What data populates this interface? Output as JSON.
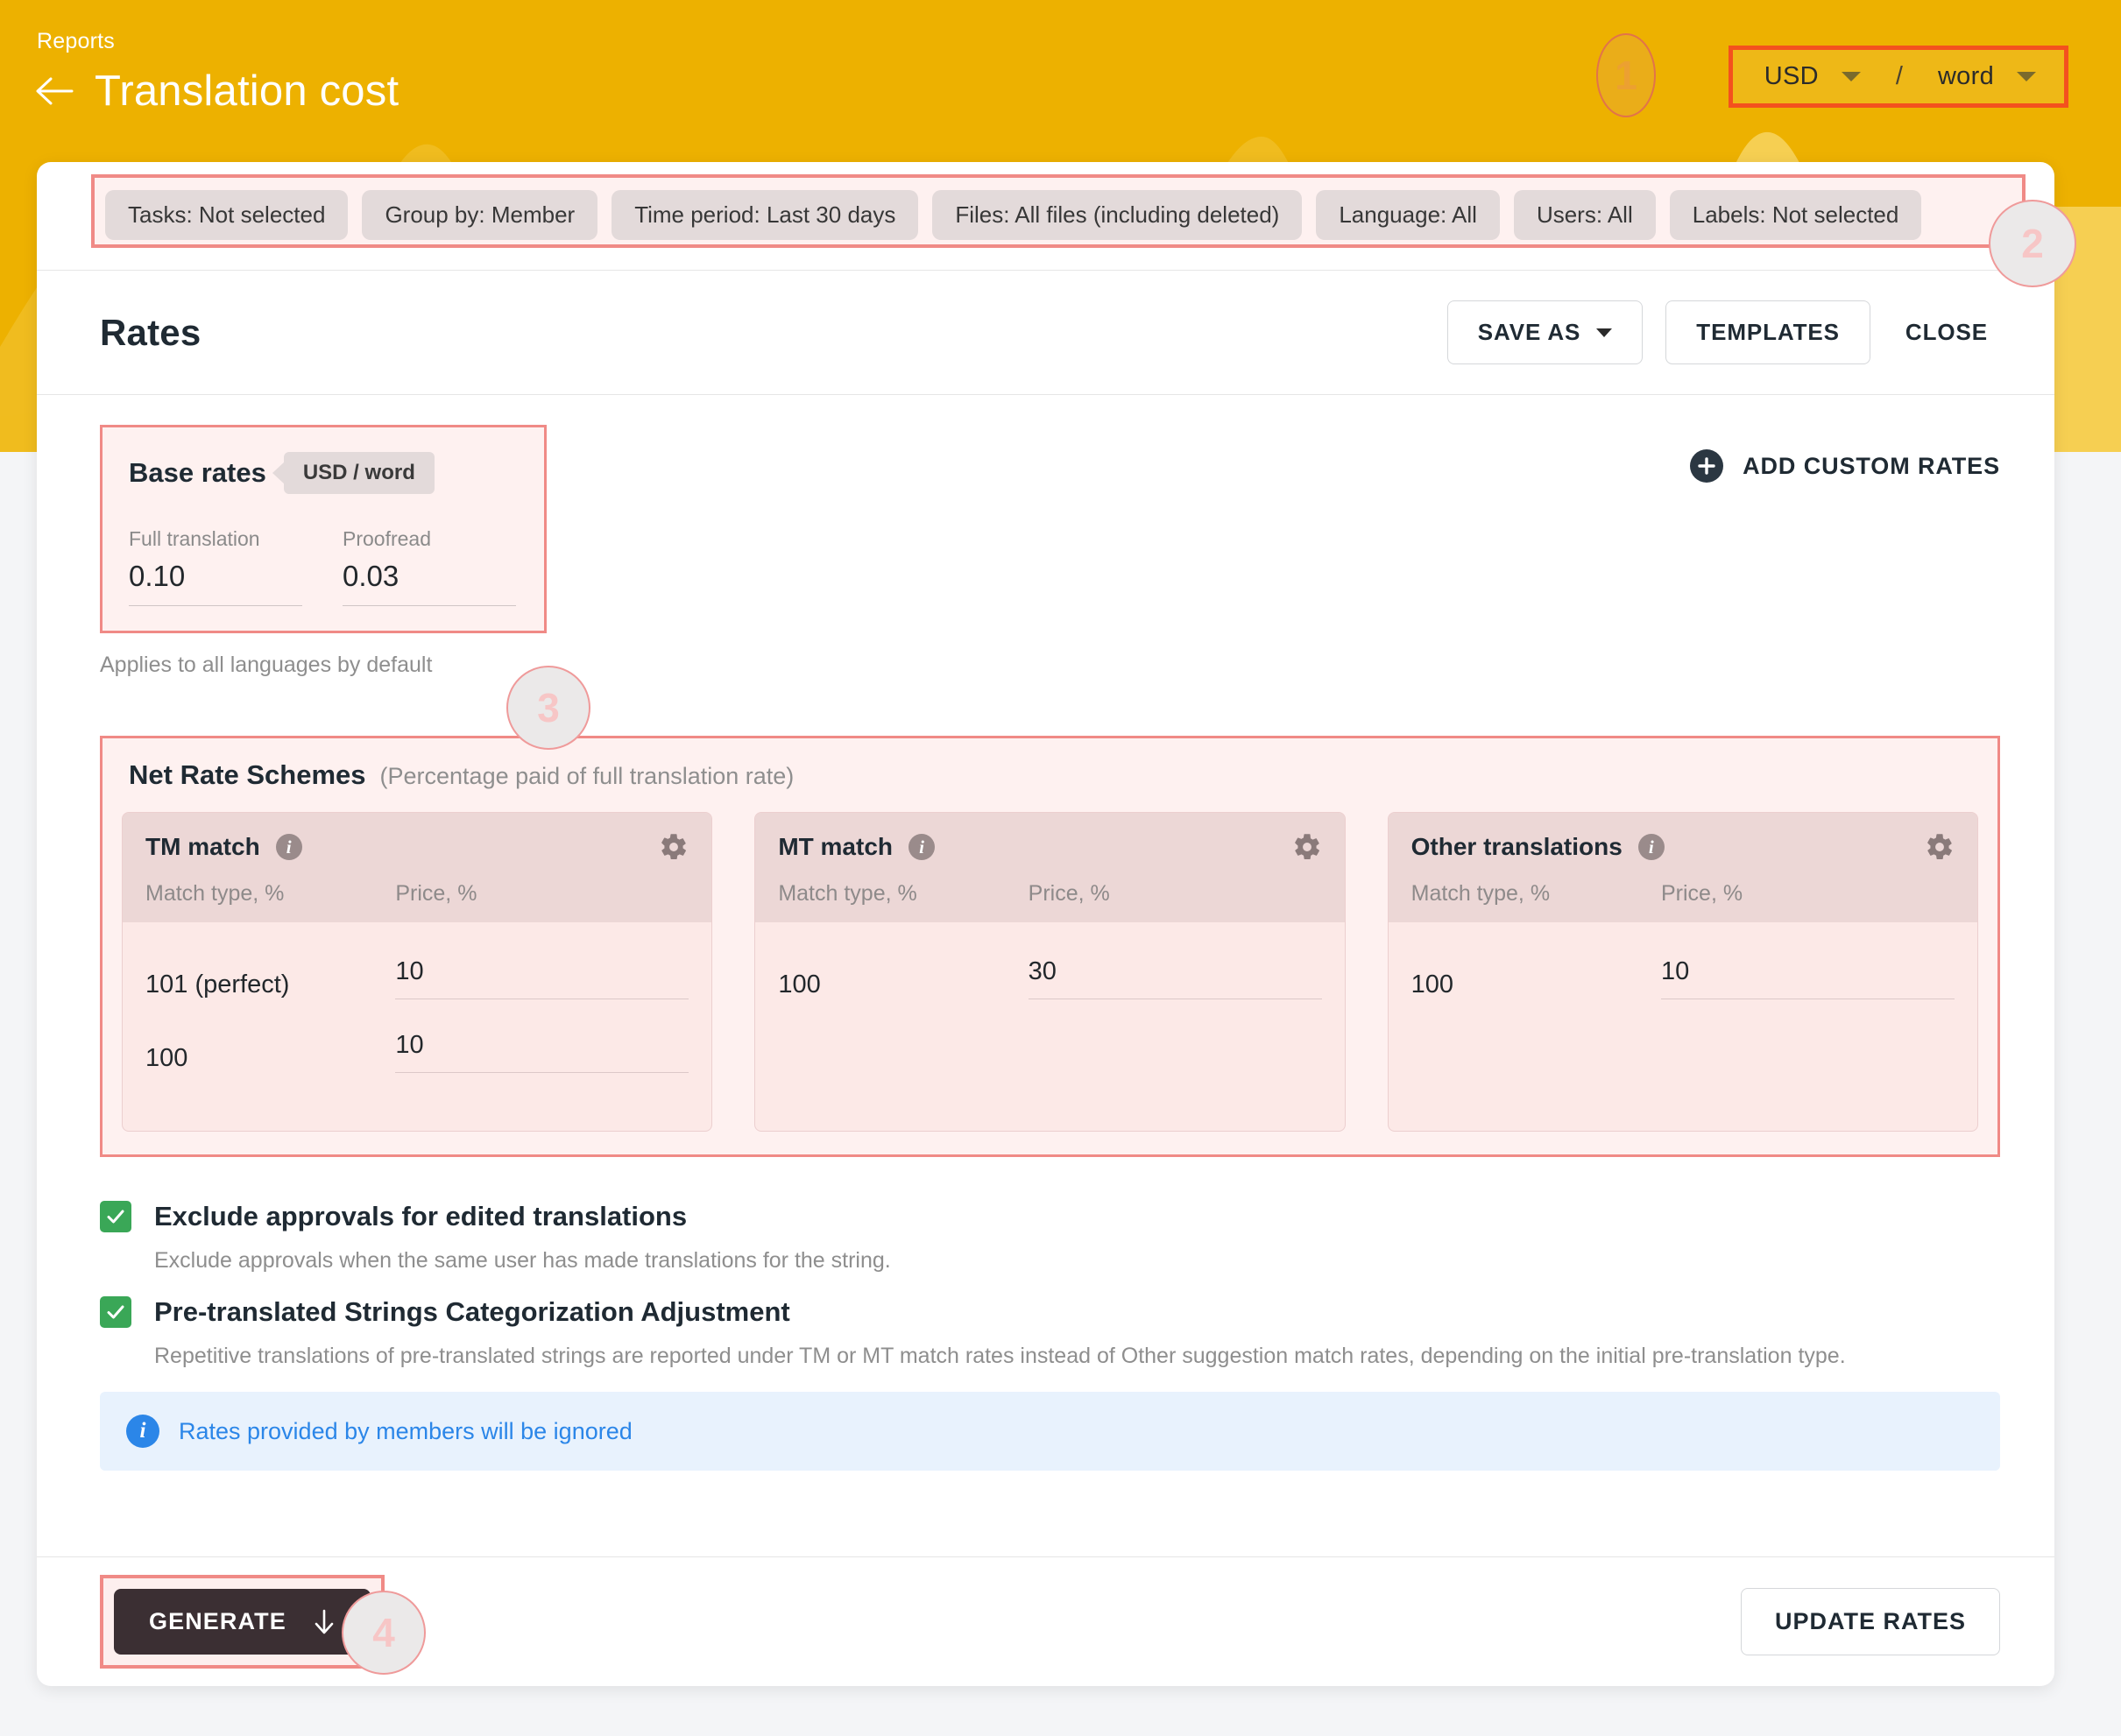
{
  "header": {
    "breadcrumb": "Reports",
    "title": "Translation cost",
    "back_icon": "arrow-left-icon",
    "currency": {
      "currency_value": "USD",
      "separator": "/",
      "unit_value": "word"
    }
  },
  "steps": {
    "one": "1",
    "two": "2",
    "three": "3",
    "four": "4"
  },
  "filters": [
    {
      "label": "Tasks: Not selected"
    },
    {
      "label": "Group by: Member"
    },
    {
      "label": "Time period: Last 30 days"
    },
    {
      "label": "Files: All files (including deleted)"
    },
    {
      "label": "Language: All"
    },
    {
      "label": "Users: All"
    },
    {
      "label": "Labels: Not selected"
    }
  ],
  "rates": {
    "title": "Rates",
    "save_as_label": "SAVE AS",
    "templates_label": "TEMPLATES",
    "close_label": "CLOSE"
  },
  "base_rates": {
    "title": "Base rates",
    "unit_tag": "USD / word",
    "full_translation_label": "Full translation",
    "full_translation_value": "0.10",
    "proofread_label": "Proofread",
    "proofread_value": "0.03",
    "note": "Applies to all languages by default"
  },
  "add_custom_rates": {
    "label": "ADD CUSTOM RATES",
    "icon": "plus-circle-icon"
  },
  "net_rate_schemes": {
    "title": "Net Rate Schemes",
    "subtitle": "(Percentage paid of full translation rate)",
    "col_match": "Match type, %",
    "col_price": "Price, %",
    "schemes": [
      {
        "name": "TM match",
        "rows": [
          {
            "match": "101 (perfect)",
            "price": "10"
          },
          {
            "match": "100",
            "price": "10"
          }
        ]
      },
      {
        "name": "MT match",
        "rows": [
          {
            "match": "100",
            "price": "30"
          }
        ]
      },
      {
        "name": "Other translations",
        "rows": [
          {
            "match": "100",
            "price": "10"
          }
        ]
      }
    ]
  },
  "options": {
    "exclude_approvals_label": "Exclude approvals for edited translations",
    "exclude_approvals_desc": "Exclude approvals when the same user has made translations for the string.",
    "pretranslated_label": "Pre-translated Strings Categorization Adjustment",
    "pretranslated_desc": "Repetitive translations of pre-translated strings are reported under TM or MT match rates instead of Other suggestion match rates, depending on the initial pre-translation type."
  },
  "notice": {
    "text": "Rates provided by members will be ignored"
  },
  "footer": {
    "generate_label": "GENERATE",
    "update_rates_label": "UPDATE RATES"
  },
  "colors": {
    "header_yellow": "#edb100",
    "highlight_pink": "#f08a86",
    "highlight_orange": "#f4511e",
    "accent_blue": "#2b86e8",
    "check_green": "#3aa757",
    "dark_button": "#3b2f33"
  }
}
